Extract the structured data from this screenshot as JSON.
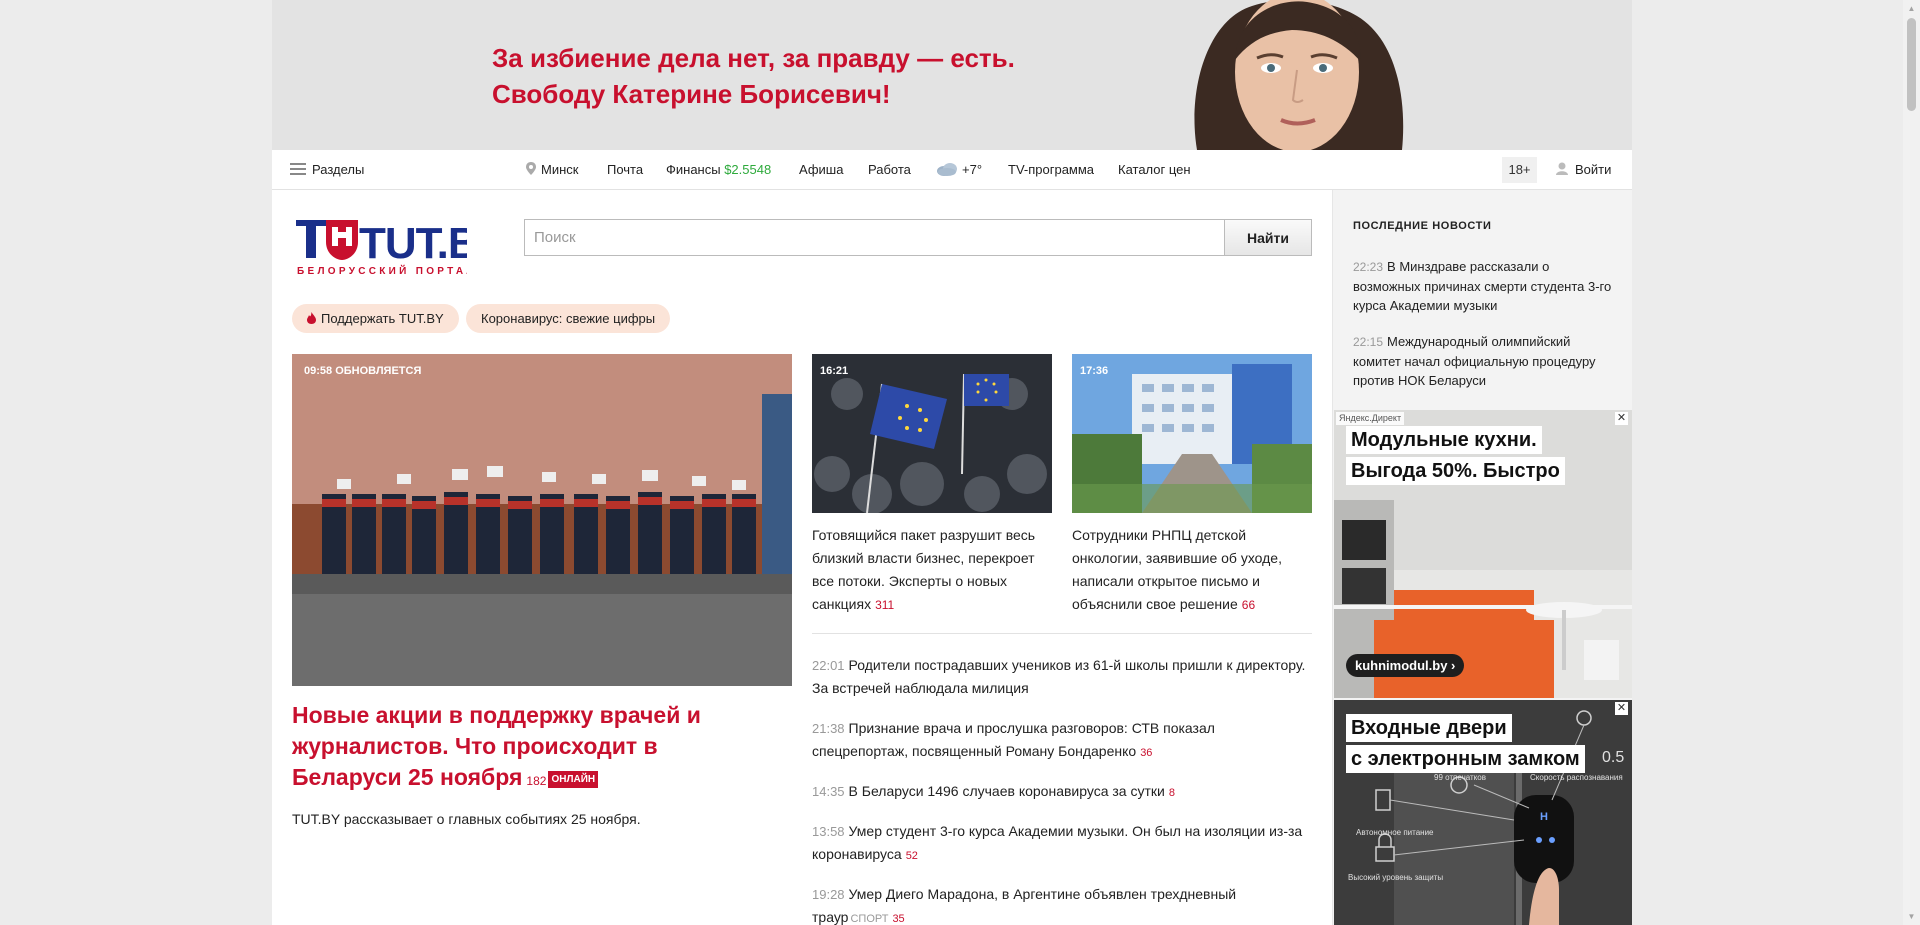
{
  "banner": {
    "line1": "За избиение дела нет, за правду — есть.",
    "line2": "Свободу Катерине Борисевич!"
  },
  "nav": {
    "sections": "Разделы",
    "city": "Минск",
    "mail": "Почта",
    "finance": "Финансы",
    "rate": "$2.5548",
    "afisha": "Афиша",
    "work": "Работа",
    "temp": "+7°",
    "tv": "TV-программа",
    "catalog": "Каталог цен",
    "age": "18+",
    "login": "Войти"
  },
  "logo": {
    "name": "TUT.BY",
    "tagline": "БЕЛОРУССКИЙ ПОРТАЛ"
  },
  "search": {
    "placeholder": "Поиск",
    "button": "Найти"
  },
  "pills": {
    "support": "Поддержать TUT.BY",
    "covid": "Коронавирус: свежие цифры"
  },
  "lead": {
    "time": "09:58 ОБНОВЛЯЕТСЯ",
    "title": "Новые акции в поддержку врачей и журналистов. Что происходит в Беларуси 25 ноября",
    "count": "182",
    "badge": "ОНЛАЙН",
    "desc": "TUT.BY рассказывает о главных событиях 25 ноября."
  },
  "cards": [
    {
      "time": "16:21",
      "title": "Готовящийся пакет разрушит весь близкий власти бизнес, перекроет все потоки. Эксперты о новых санкциях",
      "count": "311"
    },
    {
      "time": "17:36",
      "title": "Сотрудники РНПЦ детской онкологии, заявившие об уходе, написали открытое письмо и объяснили свое решение",
      "count": "66"
    }
  ],
  "news": [
    {
      "time": "22:01",
      "title": "Родители пострадавших учеников из 61-й школы пришли к директору. За встречей наблюдала милиция",
      "rubric": "",
      "count": ""
    },
    {
      "time": "21:38",
      "title": "Признание врача и прослушка разговоров: СТВ показал спецрепортаж, посвященный Роману Бондаренко",
      "rubric": "",
      "count": "36"
    },
    {
      "time": "14:35",
      "title": "В Беларуси 1496 случаев коронавируса за сутки",
      "rubric": "",
      "count": "8"
    },
    {
      "time": "13:58",
      "title": "Умер студент 3-го курса Академии музыки. Он был на изоляции из-за коронавируса",
      "rubric": "",
      "count": "52"
    },
    {
      "time": "19:28",
      "title": "Умер Диего Марадона, в Аргентине объявлен трехдневный траур",
      "rubric": "СПОРТ",
      "count": "35"
    }
  ],
  "sidebar": {
    "heading": "ПОСЛЕДНИЕ НОВОСТИ",
    "items": [
      {
        "time": "22:23",
        "title": "В Минздраве рассказали о возможных причинах смерти студента 3-го курса Академии музыки"
      },
      {
        "time": "22:15",
        "title": "Международный олимпийский комитет начал официальную процедуру против НОК Беларуси"
      }
    ]
  },
  "ads": [
    {
      "tag": "Яндекс.Директ",
      "line1": "Модульные кухни.",
      "line2": "Выгода 50%. Быстро",
      "site": "kuhnimodul.by ›",
      "close": "✕"
    },
    {
      "line1": "Входные двери",
      "line2": "с электронным замком",
      "close": "✕",
      "features": [
        "Автономное питание",
        "99 отпечатков",
        "Скорость распознавания",
        "Высокий уровень защиты"
      ],
      "seconds": "0.5"
    }
  ],
  "colors": {
    "accent": "#c8102e",
    "brand_blue": "#1a2f8a",
    "green": "#2eaa3c"
  }
}
